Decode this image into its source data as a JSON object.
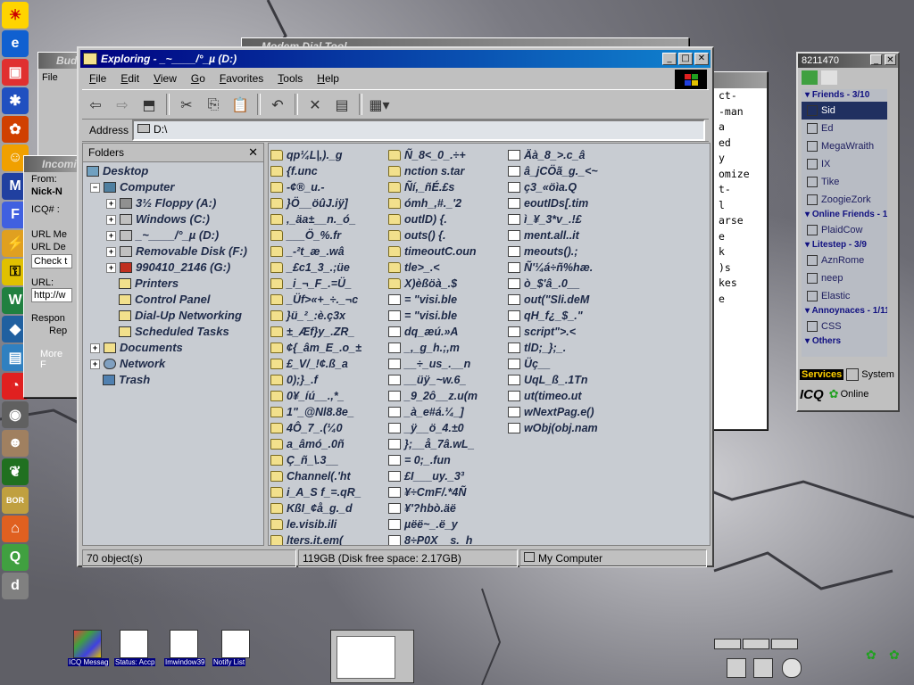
{
  "desktop": {
    "left_icons": [
      "sun-icon",
      "ie-icon",
      "network-icon",
      "puzzle-icon",
      "runner-icon",
      "app-icon",
      "ftp-icon",
      "lightning-icon",
      "key-icon",
      "word-icon",
      "cube-icon",
      "box-icon",
      "pie-icon",
      "eye-icon",
      "portrait-icon",
      "leaf-icon",
      "borland-icon",
      "house-icon",
      "quake-icon",
      "d-icon"
    ]
  },
  "bg_windows": {
    "budget": {
      "title": "Bud"
    },
    "incoming": {
      "title": "Incomi",
      "from_label": "From:",
      "from_value": "Nick-N",
      "icq_label": "ICQ# :",
      "url_me": "URL Me",
      "url_de": "URL De",
      "check": "Check t",
      "url": "URL:",
      "url_value": "http://w",
      "respon": "Respon",
      "rep": "Rep",
      "more": "More F"
    },
    "text_window": {
      "lines": [
        "ct-",
        "-man",
        "a",
        "ed",
        "y",
        "omize",
        "t-",
        "l",
        "arse",
        "e",
        "k",
        ")s",
        "kes",
        "e"
      ]
    },
    "back_title": "Modem Dial Tool"
  },
  "explorer": {
    "title": "Exploring - _~____/°_µ (D:)",
    "menu": [
      "File",
      "Edit",
      "View",
      "Go",
      "Favorites",
      "Tools",
      "Help"
    ],
    "address_label": "Address",
    "address_value": "D:\\",
    "folders_label": "Folders",
    "tree": [
      {
        "label": "Desktop",
        "icon": "desktop-icon"
      },
      {
        "label": "Computer",
        "icon": "computer-icon"
      },
      {
        "label": "3½ Floppy (A:)",
        "icon": "floppy-icon"
      },
      {
        "label": "Windows (C:)",
        "icon": "drive-icon"
      },
      {
        "label": "_~____/°_µ (D:)",
        "icon": "drive-icon"
      },
      {
        "label": "Removable Disk (F:)",
        "icon": "drive-icon"
      },
      {
        "label": "990410_2146 (G:)",
        "icon": "cdrom-icon"
      },
      {
        "label": "Printers",
        "icon": "printer-folder-icon"
      },
      {
        "label": "Control Panel",
        "icon": "control-panel-icon"
      },
      {
        "label": "Dial-Up Networking",
        "icon": "dialup-icon"
      },
      {
        "label": "Scheduled Tasks",
        "icon": "tasks-icon"
      },
      {
        "label": "Documents",
        "icon": "documents-icon"
      },
      {
        "label": "Network",
        "icon": "network-icon"
      },
      {
        "label": "Trash",
        "icon": "trash-icon"
      }
    ],
    "files_col1": [
      "qp¼L|,)._g",
      "{f.unc",
      "-¢®_u.-",
      "}Ö__öûJ.iÿ]",
      ",_äa±__n._ó_",
      "___Ö_%.fr",
      "_-²t_æ_.wâ",
      "_£c1_3_.;üe",
      "_i_¬_F_.=Ü_",
      "_Üf>«+_÷._¬c",
      "}ü_²_:è.ç3x",
      "±_Æf}y_.ZR_",
      "¢{_âm_E_.o_±",
      "£_V/_!¢.ß_a",
      "0);}_.f",
      "0¥_íú__.,*_",
      "1\"_@Nl8.8e_",
      "4Ô_7_.(¼0",
      "a_âmó_.0ñ",
      "Ç_ñ_\\.3__",
      "Channel(.'ht",
      "i_A_S f_=.qR_",
      "KßI_¢å_g._d",
      "le.visib.ili",
      "lters.it.em("
    ],
    "files_col2": [
      "Ñ_8<_0_.÷+",
      "nction s.tar",
      "Ñí,_ñÉ.£s",
      "ómh_,#._'2",
      "outlD) {.",
      "outs() {.",
      "timeoutC.oun",
      "tle>_.<",
      "X)èßöà_.$",
      "= \"visi.ble",
      "= \"visi.ble",
      "dq_æú.»A",
      "_,_g_h.;,m",
      "__÷_us_.__n",
      "__üÿ_~w.6_",
      "_9_2ô__z.u(m",
      "_à_e#á.¼_]",
      "_ÿ__ö_4.±0",
      "};__å_7â.wL_",
      "= 0;_.fun",
      "£I___uy._3³",
      "¥÷CmF/.*4Ñ",
      "¥'?hbò.äë",
      "µëë~_.ë_y",
      "8÷P0X__s._h"
    ],
    "files_col3": [
      "Äà_8_>.c_â",
      "â_jCÖã_g._<~",
      "ç3_«öìa.Q",
      "eoutIDs[.tim",
      "ì_¥_3*v_.!£",
      "ment.all..it",
      "meouts().;",
      "Ñ'¼á÷ñ%hæ.",
      "ò_$'â_.0__",
      "out(\"Sli.deM",
      "qH_f¿_$_.\"",
      "script\">.<",
      "tlD;_};_.",
      "Üç__",
      "UqL_ß_.1Tn",
      "ut(timeo.ut",
      "wNextPag.e()",
      "wObj(obj.nam"
    ],
    "status": {
      "objects": "70 object(s)",
      "size": "119GB (Disk free space: 2.17GB)",
      "location": "My Computer"
    }
  },
  "icq": {
    "title": "8211470",
    "groups": [
      {
        "name": "Friends - 3/10",
        "type": "group"
      },
      {
        "name": "Sid",
        "type": "contact",
        "selected": true
      },
      {
        "name": "Ed",
        "type": "contact"
      },
      {
        "name": "MegaWraith",
        "type": "contact"
      },
      {
        "name": "IX",
        "type": "contact"
      },
      {
        "name": "Tike",
        "type": "contact"
      },
      {
        "name": "ZoogieZork",
        "type": "contact"
      },
      {
        "name": "Online Friends - 1",
        "type": "group"
      },
      {
        "name": "PlaidCow",
        "type": "contact"
      },
      {
        "name": "Litestep - 3/9",
        "type": "group"
      },
      {
        "name": "AznRome",
        "type": "contact"
      },
      {
        "name": "neep",
        "type": "contact"
      },
      {
        "name": "Elastic",
        "type": "contact"
      },
      {
        "name": "Annoynaces - 1/11",
        "type": "group"
      },
      {
        "name": "CSS",
        "type": "contact"
      },
      {
        "name": "Others",
        "type": "group"
      }
    ],
    "services": "Services",
    "system": "System",
    "icq_logo": "ICQ",
    "online": "Online"
  },
  "taskbar": {
    "items": [
      "ICQ Messag",
      "Status: Accp",
      "Imwindow39",
      "Notify List"
    ]
  }
}
